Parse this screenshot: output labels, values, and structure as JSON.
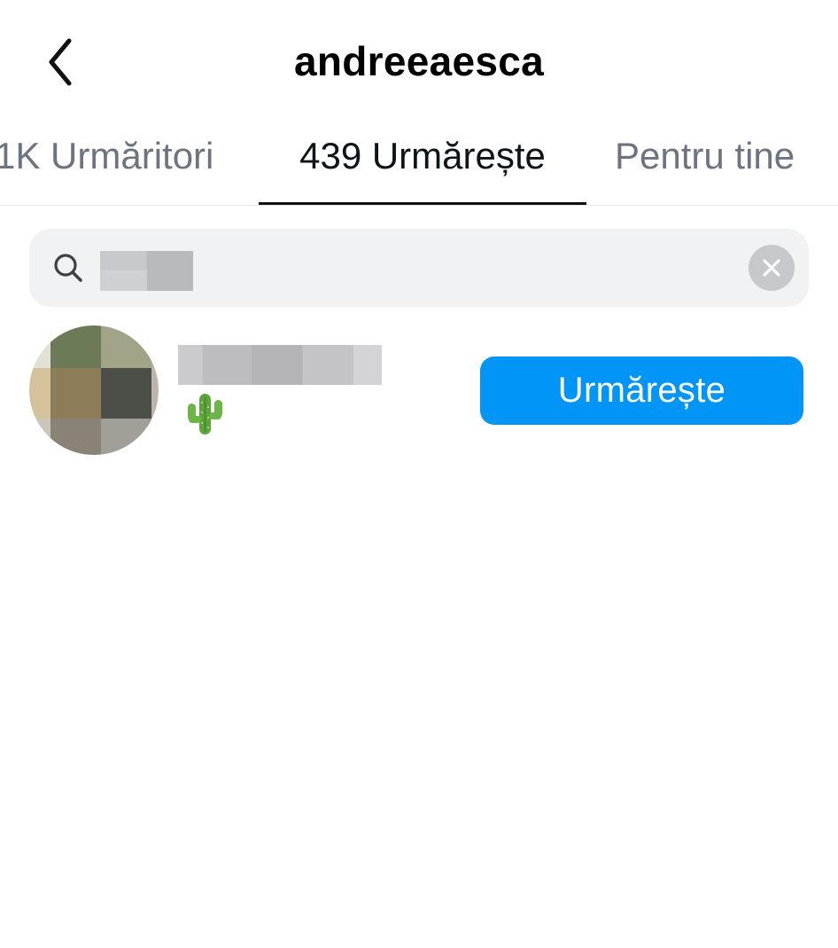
{
  "header": {
    "title": "andreeaesca",
    "back_icon": "chevron-left-icon"
  },
  "tabs": [
    {
      "label": "1K Urmăritori",
      "active": false
    },
    {
      "label": "439 Urmărește",
      "active": true
    },
    {
      "label": "Pentru tine",
      "active": false
    }
  ],
  "search": {
    "value": "",
    "search_icon": "search-icon",
    "clear_icon": "clear-circle-icon",
    "value_redacted": true
  },
  "results": [
    {
      "username_redacted": true,
      "subtitle_icon": "cactus-icon",
      "follow_label": "Urmărește"
    }
  ],
  "colors": {
    "accent": "#0095f6",
    "text_primary": "#0f1419",
    "text_secondary": "#6b7480",
    "search_bg": "#f1f2f4"
  }
}
